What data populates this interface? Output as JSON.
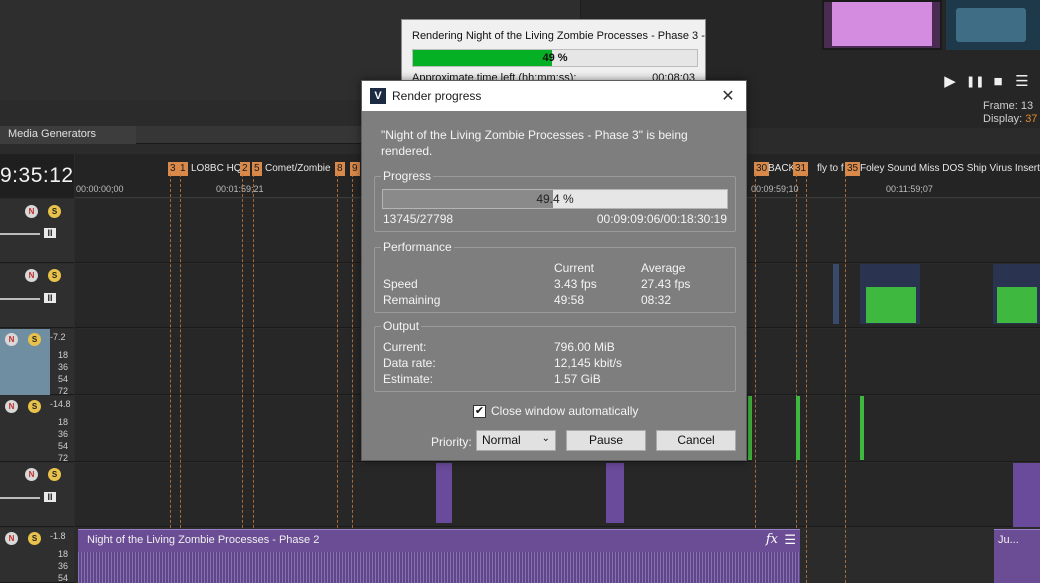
{
  "window": {
    "tab_label": "Media Generators",
    "timecode": "9:35:12"
  },
  "transport": {
    "play": "▶",
    "pause": "❚❚",
    "stop": "■",
    "menu": "☰"
  },
  "frame_info": {
    "frame_label": "Frame:",
    "frame_value": "13",
    "display_label": "Display:",
    "display_value": "37"
  },
  "ruler": {
    "ticks": [
      "00:00:00;00",
      "00:01:59;21",
      "00:09:59;10",
      "00:11:59;07"
    ],
    "markers": [
      {
        "num": "3",
        "text": ""
      },
      {
        "num": "1",
        "text": "LO8BC HQ"
      },
      {
        "num": "2",
        "text": ""
      },
      {
        "num": "5",
        "text": "Comet/Zombie"
      },
      {
        "num": "8",
        "text": ""
      },
      {
        "num": "9",
        "text": ""
      },
      {
        "num": "30",
        "text": "BACK"
      },
      {
        "num": "31",
        "text": "fly to f"
      },
      {
        "num": "35",
        "text": "Foley Sound Miss DOS Ship Virus Insert H"
      }
    ]
  },
  "tracks": {
    "mute_icon": "N",
    "solo_icon": "S",
    "pause_icon": "II",
    "levels": [
      "-7.2",
      "-14.8",
      "-1.8"
    ],
    "db_scale": [
      "18",
      "36",
      "54",
      "72"
    ]
  },
  "audio_clips": {
    "main_label": "Night of the Living Zombie Processes - Phase 2",
    "fx": "fx",
    "menu": "☰",
    "side_label": "Ju..."
  },
  "bg_render": {
    "title": "Rendering Night of the Living Zombie Processes - Phase 3 -",
    "percent_text": "49 %",
    "percent": 49,
    "time_label": "Approximate time left (hh:mm:ss):",
    "time_value": "00:08:03"
  },
  "dialog": {
    "title": "Render progress",
    "app_icon": "V",
    "close": "✕",
    "message": "\"Night of the Living Zombie Processes - Phase 3\" is being rendered.",
    "progress": {
      "group_title": "Progress",
      "percent_text": "49.4 %",
      "percent": 49.4,
      "frames": "13745/27798",
      "time": "00:09:09:06/00:18:30:19"
    },
    "performance": {
      "group_title": "Performance",
      "col_current": "Current",
      "col_average": "Average",
      "speed_label": "Speed",
      "speed_current": "3.43 fps",
      "speed_average": "27.43 fps",
      "remaining_label": "Remaining",
      "remaining_current": "49:58",
      "remaining_average": "08:32"
    },
    "output": {
      "group_title": "Output",
      "current_label": "Current:",
      "current_value": "796.00 MiB",
      "rate_label": "Data rate:",
      "rate_value": "12,145 kbit/s",
      "estimate_label": "Estimate:",
      "estimate_value": "1.57 GiB"
    },
    "close_auto_label": "Close window automatically",
    "close_auto_checked": true,
    "priority_label": "Priority:",
    "priority_value": "Normal",
    "pause_label": "Pause",
    "cancel_label": "Cancel"
  },
  "colors": {
    "marker": "#d98a4a",
    "clip_purple": "#6b4d95",
    "green_bar": "#06b025"
  }
}
